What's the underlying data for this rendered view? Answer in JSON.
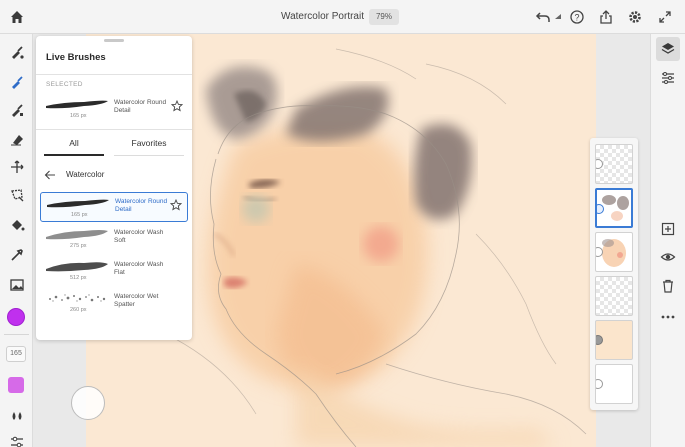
{
  "app": {
    "doc_title": "Watercolor Portrait",
    "zoom": "79%"
  },
  "toolbar": {
    "home_icon": "home-icon",
    "right_icons": [
      "undo-icon",
      "help-icon",
      "share-icon",
      "settings-icon",
      "fullscreen-icon"
    ]
  },
  "left_tools": [
    "live-brush-icon",
    "pixel-brush-icon",
    "vector-brush-icon",
    "eraser-icon",
    "transform-icon",
    "lasso-icon",
    "fill-icon",
    "eyedropper-icon",
    "image-icon"
  ],
  "color": {
    "current": "#c030ee",
    "flow": "#d66ae8"
  },
  "size_chip": "165",
  "panel": {
    "title": "Live Brushes",
    "selected_label": "SELECTED",
    "selected_brush": {
      "name": "Watercolor Round Detail",
      "size": "165 px"
    },
    "tabs": {
      "all": "All",
      "favorites": "Favorites"
    },
    "category": "Watercolor",
    "brushes": [
      {
        "name": "Watercolor Round Detail",
        "size": "165 px",
        "selected": true
      },
      {
        "name": "Watercolor Wash Soft",
        "size": "275 px",
        "selected": false
      },
      {
        "name": "Watercolor Wash Flat",
        "size": "512 px",
        "selected": false
      },
      {
        "name": "Watercolor Wet Spatter",
        "size": "260 px",
        "selected": false
      }
    ]
  },
  "right_tools": [
    "layers-icon",
    "layer-properties-icon",
    "add-layer-icon",
    "visibility-icon",
    "delete-icon",
    "more-icon"
  ],
  "layers": [
    {
      "kind": "empty",
      "active": false
    },
    {
      "kind": "hair",
      "active": true
    },
    {
      "kind": "face",
      "active": false
    },
    {
      "kind": "empty",
      "active": false
    },
    {
      "kind": "paper",
      "active": false
    },
    {
      "kind": "background",
      "active": false
    }
  ],
  "canvas": {
    "paper_color": "#fbe8d3"
  }
}
